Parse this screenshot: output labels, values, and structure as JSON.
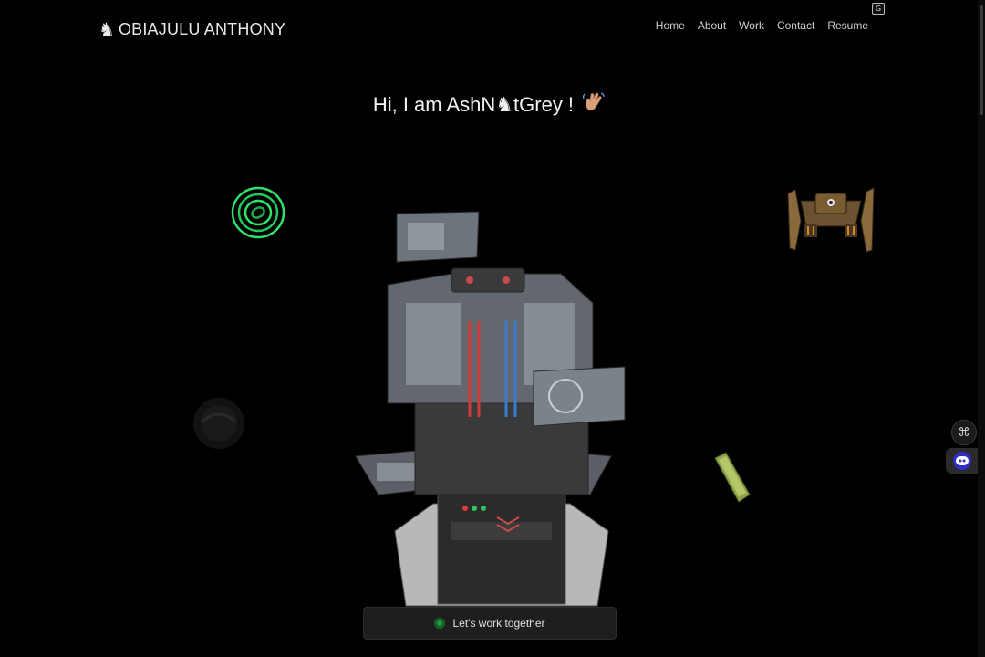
{
  "brand": {
    "name": "OBIAJULU ANTHONY",
    "logo_glyph": "♞"
  },
  "nav": {
    "items": [
      "Home",
      "About",
      "Work",
      "Contact",
      "Resume"
    ]
  },
  "hero": {
    "greeting": "Hi, I am AshN",
    "greeting_glyph": "♞",
    "greeting_tail": "tGrey !",
    "wave_icon": "waving-hand-icon"
  },
  "cta": {
    "label": "Let's work together",
    "status_color": "#1f9b3d"
  },
  "widgets": {
    "menu_icon": "command-icon",
    "chat_icon": "chatbot-icon",
    "translate_icon": "translate-icon"
  },
  "colors": {
    "background": "#000000",
    "text": "#e8e8e8",
    "accent_green": "#22c55e"
  }
}
